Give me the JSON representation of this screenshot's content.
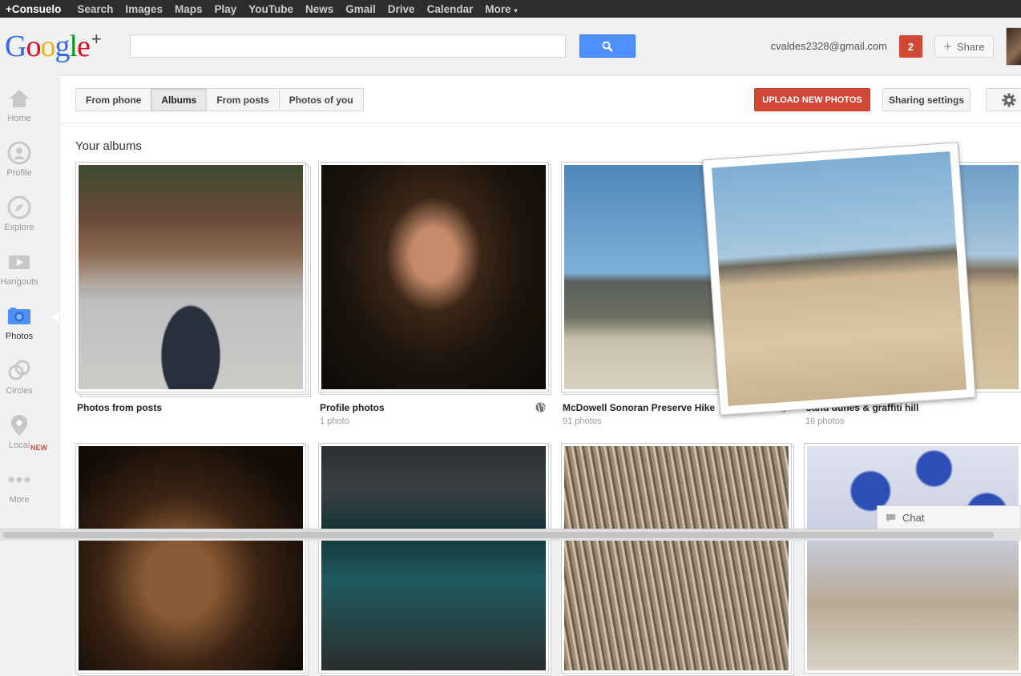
{
  "topbar": {
    "links": [
      "+Consuelo",
      "Search",
      "Images",
      "Maps",
      "Play",
      "YouTube",
      "News",
      "Gmail",
      "Drive",
      "Calendar",
      "More"
    ]
  },
  "header": {
    "logo_text": "Google",
    "logo_plus": "+",
    "search_placeholder": "",
    "email": "cvaldes2328@gmail.com",
    "notification_count": "2",
    "share_label": "Share"
  },
  "sidebar": {
    "items": [
      {
        "label": "Home",
        "icon": "home-icon"
      },
      {
        "label": "Profile",
        "icon": "profile-icon"
      },
      {
        "label": "Explore",
        "icon": "compass-icon"
      },
      {
        "label": "Hangouts",
        "icon": "video-camera-icon"
      },
      {
        "label": "Photos",
        "icon": "camera-icon"
      },
      {
        "label": "Circles",
        "icon": "circles-icon"
      },
      {
        "label": "Local",
        "icon": "map-pin-icon",
        "badge": "NEW"
      },
      {
        "label": "More",
        "icon": "more-dots-icon"
      }
    ],
    "active": "Photos"
  },
  "toolbar": {
    "tabs": [
      "From phone",
      "Albums",
      "From posts",
      "Photos of you"
    ],
    "active_tab": "Albums",
    "upload_label": "UPLOAD NEW PHOTOS",
    "sharing_label": "Sharing settings"
  },
  "content": {
    "section_title": "Your albums",
    "albums": [
      {
        "name": "Photos from posts",
        "count": "",
        "public": false
      },
      {
        "name": "Profile photos",
        "count": "1 photo",
        "public": true
      },
      {
        "name": "McDowell Sonoran Preserve Hike",
        "count": "91 photos",
        "public": true
      },
      {
        "name": "Sand dunes & graffiti hill",
        "count": "16 photos",
        "public": false
      }
    ]
  },
  "chat": {
    "label": "Chat"
  },
  "colors": {
    "accent_red": "#d14836",
    "search_blue": "#4d90fe",
    "topbar_bg": "#2d2d2d"
  }
}
